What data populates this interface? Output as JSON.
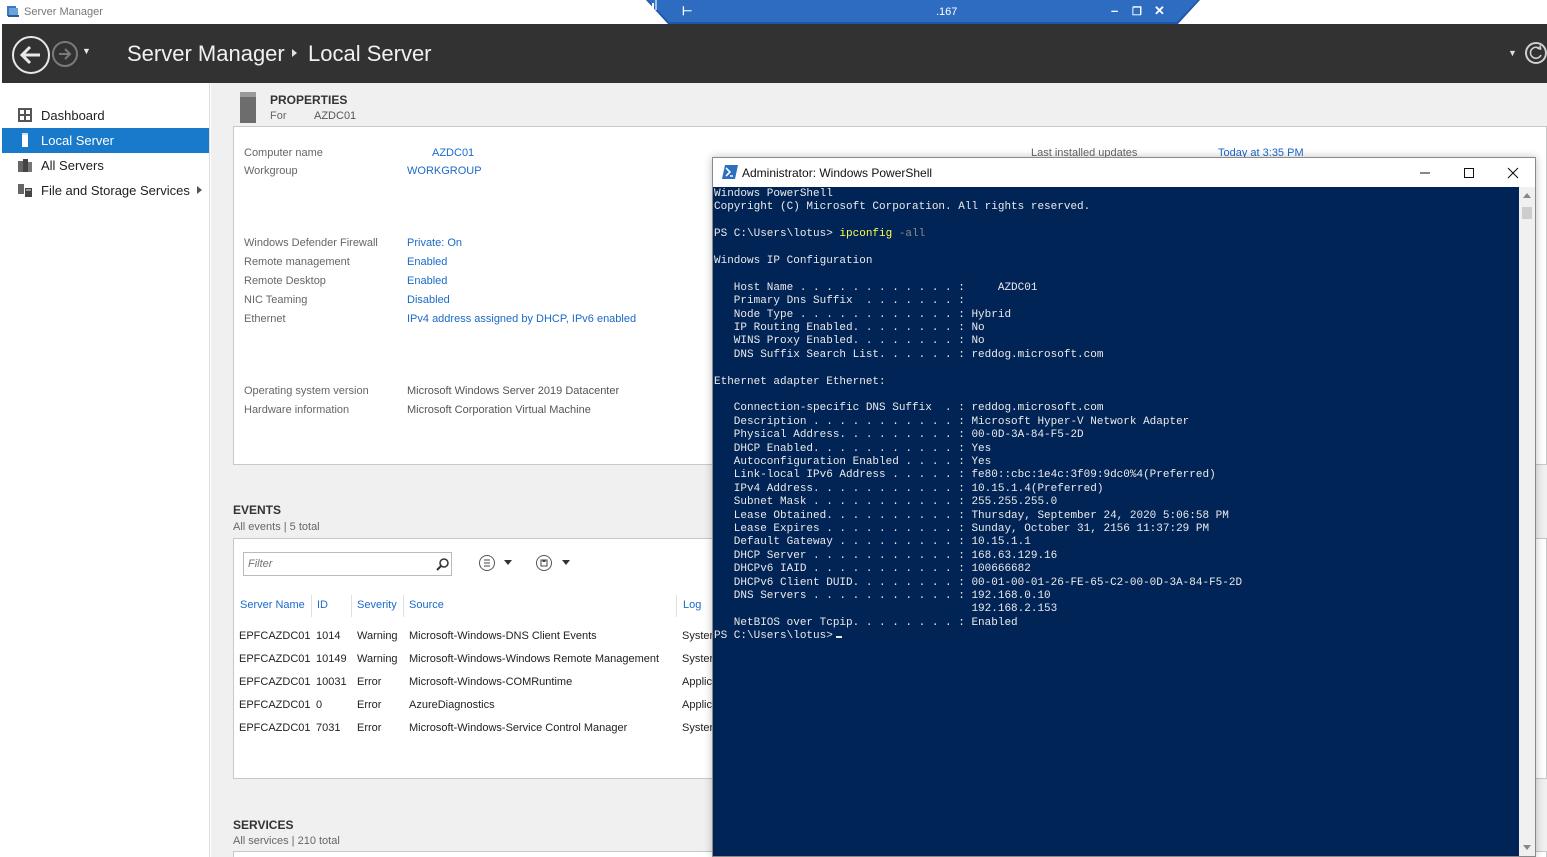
{
  "window": {
    "title": "Server Manager"
  },
  "rdp": {
    "host": ".167"
  },
  "header": {
    "crumb_root": "Server Manager",
    "crumb_page": "Local Server"
  },
  "sidebar": {
    "items": [
      {
        "label": "Dashboard",
        "icon": "dashboard-icon"
      },
      {
        "label": "Local Server",
        "icon": "server-icon"
      },
      {
        "label": "All Servers",
        "icon": "servers-icon"
      },
      {
        "label": "File and Storage Services",
        "icon": "storage-icon"
      }
    ]
  },
  "properties": {
    "title": "PROPERTIES",
    "for_label": "For",
    "for_value": "AZDC01",
    "rows": [
      {
        "label": "Computer name",
        "value": "AZDC01"
      },
      {
        "label": "Workgroup",
        "value": "WORKGROUP"
      },
      {
        "label": "Windows Defender Firewall",
        "value": "Private: On"
      },
      {
        "label": "Remote management",
        "value": "Enabled"
      },
      {
        "label": "Remote Desktop",
        "value": "Enabled"
      },
      {
        "label": "NIC Teaming",
        "value": "Disabled"
      },
      {
        "label": "Ethernet",
        "value": "IPv4 address assigned by DHCP, IPv6 enabled"
      },
      {
        "label": "Operating system version",
        "value": "Microsoft Windows Server 2019 Datacenter"
      },
      {
        "label": "Hardware information",
        "value": "Microsoft Corporation Virtual Machine"
      }
    ],
    "updates_label": "Last installed updates",
    "updates_value": "Today at 3:35 PM"
  },
  "events": {
    "title": "EVENTS",
    "subtitle": "All events | 5 total",
    "filter_placeholder": "Filter",
    "columns": [
      "Server Name",
      "ID",
      "Severity",
      "Source",
      "Log"
    ],
    "rows": [
      {
        "server": "EPFCAZDC01",
        "id": "1014",
        "severity": "Warning",
        "source": "Microsoft-Windows-DNS Client Events",
        "log": "Syster"
      },
      {
        "server": "EPFCAZDC01",
        "id": "10149",
        "severity": "Warning",
        "source": "Microsoft-Windows-Windows Remote Management",
        "log": "Syster"
      },
      {
        "server": "EPFCAZDC01",
        "id": "10031",
        "severity": "Error",
        "source": "Microsoft-Windows-COMRuntime",
        "log": "Applic"
      },
      {
        "server": "EPFCAZDC01",
        "id": "0",
        "severity": "Error",
        "source": "AzureDiagnostics",
        "log": "Applic"
      },
      {
        "server": "EPFCAZDC01",
        "id": "7031",
        "severity": "Error",
        "source": "Microsoft-Windows-Service Control Manager",
        "log": "Syster"
      }
    ]
  },
  "services": {
    "title": "SERVICES",
    "subtitle": "All services | 210 total"
  },
  "powershell": {
    "title": "Administrator: Windows PowerShell",
    "prompt": "PS C:\\Users\\lotus> ",
    "command": "ipconfig",
    "argument": " -all",
    "lines_before": [
      "Windows PowerShell",
      "Copyright (C) Microsoft Corporation. All rights reserved.",
      ""
    ],
    "lines_after": [
      "",
      "Windows IP Configuration",
      "",
      "   Host Name . . . . . . . . . . . . :     AZDC01",
      "   Primary Dns Suffix  . . . . . . . :",
      "   Node Type . . . . . . . . . . . . : Hybrid",
      "   IP Routing Enabled. . . . . . . . : No",
      "   WINS Proxy Enabled. . . . . . . . : No",
      "   DNS Suffix Search List. . . . . . : reddog.microsoft.com",
      "",
      "Ethernet adapter Ethernet:",
      "",
      "   Connection-specific DNS Suffix  . : reddog.microsoft.com",
      "   Description . . . . . . . . . . . : Microsoft Hyper-V Network Adapter",
      "   Physical Address. . . . . . . . . : 00-0D-3A-84-F5-2D",
      "   DHCP Enabled. . . . . . . . . . . : Yes",
      "   Autoconfiguration Enabled . . . . : Yes",
      "   Link-local IPv6 Address . . . . . : fe80::cbc:1e4c:3f09:9dc0%4(Preferred)",
      "   IPv4 Address. . . . . . . . . . . : 10.15.1.4(Preferred)",
      "   Subnet Mask . . . . . . . . . . . : 255.255.255.0",
      "   Lease Obtained. . . . . . . . . . : Thursday, September 24, 2020 5:06:58 PM",
      "   Lease Expires . . . . . . . . . . : Sunday, October 31, 2156 11:37:29 PM",
      "   Default Gateway . . . . . . . . . : 10.15.1.1",
      "   DHCP Server . . . . . . . . . . . : 168.63.129.16",
      "   DHCPv6 IAID . . . . . . . . . . . : 100666682",
      "   DHCPv6 Client DUID. . . . . . . . : 00-01-00-01-26-FE-65-C2-00-0D-3A-84-F5-2D",
      "   DNS Servers . . . . . . . . . . . : 192.168.0.10",
      "                                       192.168.2.153",
      "   NetBIOS over Tcpip. . . . . . . . : Enabled"
    ],
    "final_prompt": "PS C:\\Users\\lotus> "
  },
  "colors": {
    "header_bg": "#323232",
    "accent": "#1979ca",
    "link": "#1b6ac9",
    "ps_bg": "#012456",
    "ps_cmd": "#fdfd4e"
  }
}
